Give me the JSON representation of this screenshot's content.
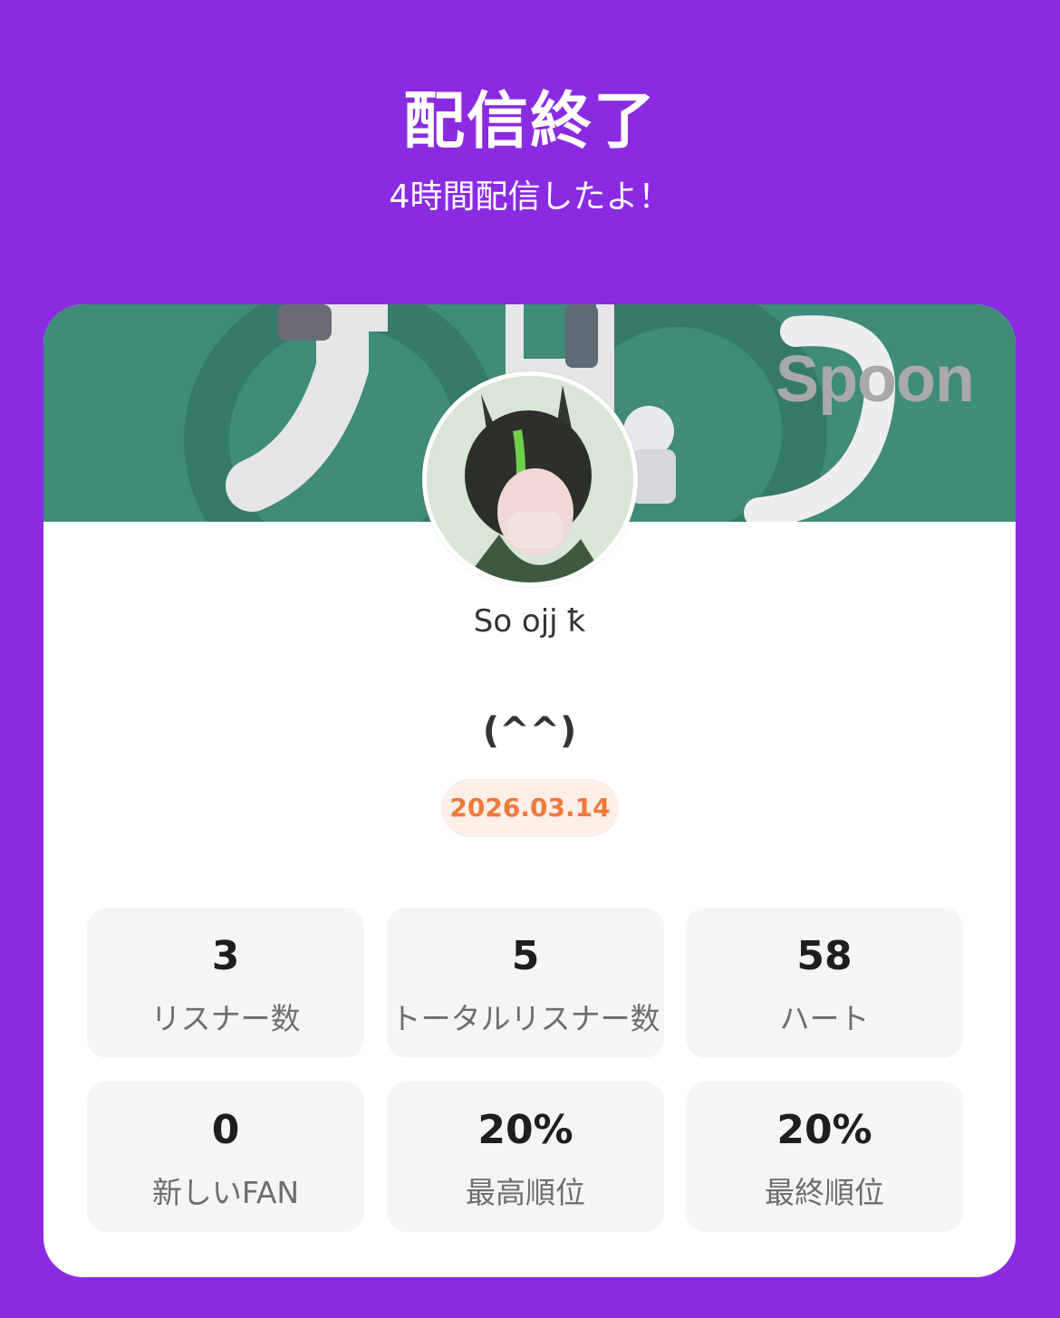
{
  "header": {
    "title": "配信終了",
    "subtitle": "4時間配信したよ！"
  },
  "banner": {
    "logo_text": "Spoon"
  },
  "profile": {
    "username": "So ojj ꝁ",
    "status_text": "(^^)",
    "date": "2026.03.14"
  },
  "stats": [
    {
      "value": "3",
      "label": "リスナー数"
    },
    {
      "value": "5",
      "label": "トータルリスナー数"
    },
    {
      "value": "58",
      "label": "ハート"
    },
    {
      "value": "0",
      "label": "新しいFAN"
    },
    {
      "value": "20%",
      "label": "最高順位"
    },
    {
      "value": "20%",
      "label": "最終順位"
    }
  ],
  "colors": {
    "background": "#8a2be2",
    "banner": "#3f8c79",
    "date_text": "#ee7a3c",
    "date_badge": "#fdeee6",
    "stat_tile": "#f5f5f5"
  }
}
